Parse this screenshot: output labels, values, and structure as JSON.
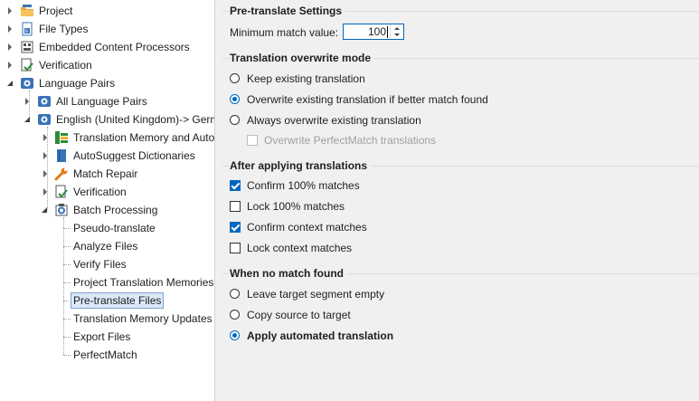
{
  "tree": {
    "items": [
      {
        "label": "Project",
        "icon": "project-folder-icon"
      },
      {
        "label": "File Types",
        "icon": "file-types-icon"
      },
      {
        "label": "Embedded Content Processors",
        "icon": "embedded-content-icon"
      },
      {
        "label": "Verification",
        "icon": "verification-icon"
      },
      {
        "label": "Language Pairs",
        "icon": "language-pairs-icon"
      },
      {
        "label": "All Language Pairs",
        "icon": "language-pairs-icon"
      },
      {
        "label": "English (United Kingdom)-> Germa",
        "icon": "language-pairs-icon"
      },
      {
        "label": "Translation Memory and Auto",
        "icon": "translation-memory-icon"
      },
      {
        "label": "AutoSuggest Dictionaries",
        "icon": "dictionary-icon"
      },
      {
        "label": "Match Repair",
        "icon": "wrench-icon"
      },
      {
        "label": "Verification",
        "icon": "verification-icon"
      },
      {
        "label": "Batch Processing",
        "icon": "batch-processing-icon"
      },
      {
        "label": "Pseudo-translate"
      },
      {
        "label": "Analyze Files"
      },
      {
        "label": "Verify Files"
      },
      {
        "label": "Project Translation Memories"
      },
      {
        "label": "Pre-translate Files"
      },
      {
        "label": "Translation Memory Updates"
      },
      {
        "label": "Export Files"
      },
      {
        "label": "PerfectMatch"
      }
    ]
  },
  "pretranslate": {
    "title": "Pre-translate Settings",
    "min_match_label": "Minimum match value:",
    "min_match_value": "100"
  },
  "overwrite": {
    "title": "Translation overwrite mode",
    "keep": "Keep existing translation",
    "overwrite_better": "Overwrite existing translation if better match found",
    "always": "Always overwrite existing translation",
    "perfectmatch": "Overwrite PerfectMatch translations",
    "selected": "overwrite_better"
  },
  "after": {
    "title": "After applying translations",
    "confirm100": "Confirm 100% matches",
    "lock100": "Lock 100% matches",
    "confirm_context": "Confirm context matches",
    "lock_context": "Lock context matches"
  },
  "nomatch": {
    "title": "When no match found",
    "leave_empty": "Leave target segment empty",
    "copy_source": "Copy source to target",
    "apply_mt": "Apply automated translation",
    "selected": "apply_mt"
  },
  "colors": {
    "accent": "#0067c0",
    "selection": "#dbe8f7"
  }
}
